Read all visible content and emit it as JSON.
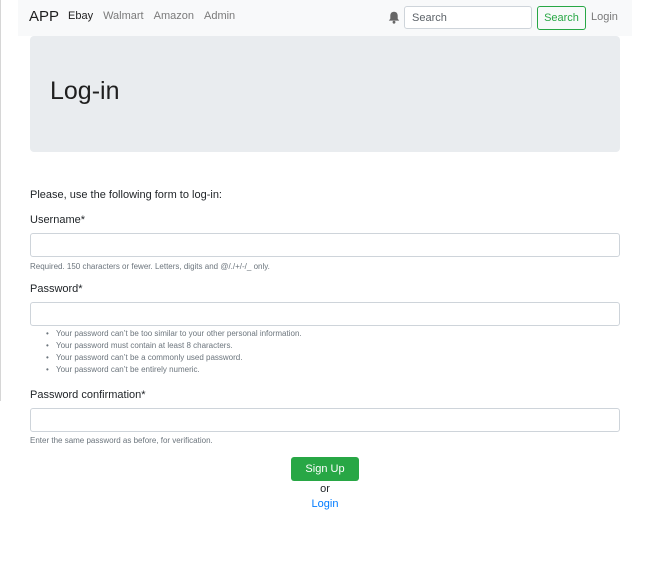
{
  "navbar": {
    "brand": "APP",
    "links": [
      {
        "label": "Ebay",
        "active": true
      },
      {
        "label": "Walmart",
        "active": false
      },
      {
        "label": "Amazon",
        "active": false
      },
      {
        "label": "Admin",
        "active": false
      }
    ],
    "notification_icon": "bell-icon",
    "search_placeholder": "Search",
    "search_button": "Search",
    "login": "Login"
  },
  "page": {
    "title": "Log-in",
    "intro": "Please, use the following form to log-in:"
  },
  "form": {
    "username_label": "Username*",
    "username_value": "",
    "username_help": "Required. 150 characters or fewer. Letters, digits and @/./+/-/_ only.",
    "password_label": "Password*",
    "password_value": "",
    "password_rules": [
      "Your password can’t be too similar to your other personal information.",
      "Your password must contain at least 8 characters.",
      "Your password can’t be a commonly used password.",
      "Your password can’t be entirely numeric."
    ],
    "confirm_label": "Password confirmation*",
    "confirm_value": "",
    "confirm_help": "Enter the same password as before, for verification.",
    "submit": "Sign Up",
    "or": "or",
    "login_link": "Login"
  },
  "colors": {
    "primary_green": "#28a745",
    "link_blue": "#007bff",
    "jumbotron_bg": "#e9ecef",
    "navbar_bg": "#f8f9fa"
  }
}
